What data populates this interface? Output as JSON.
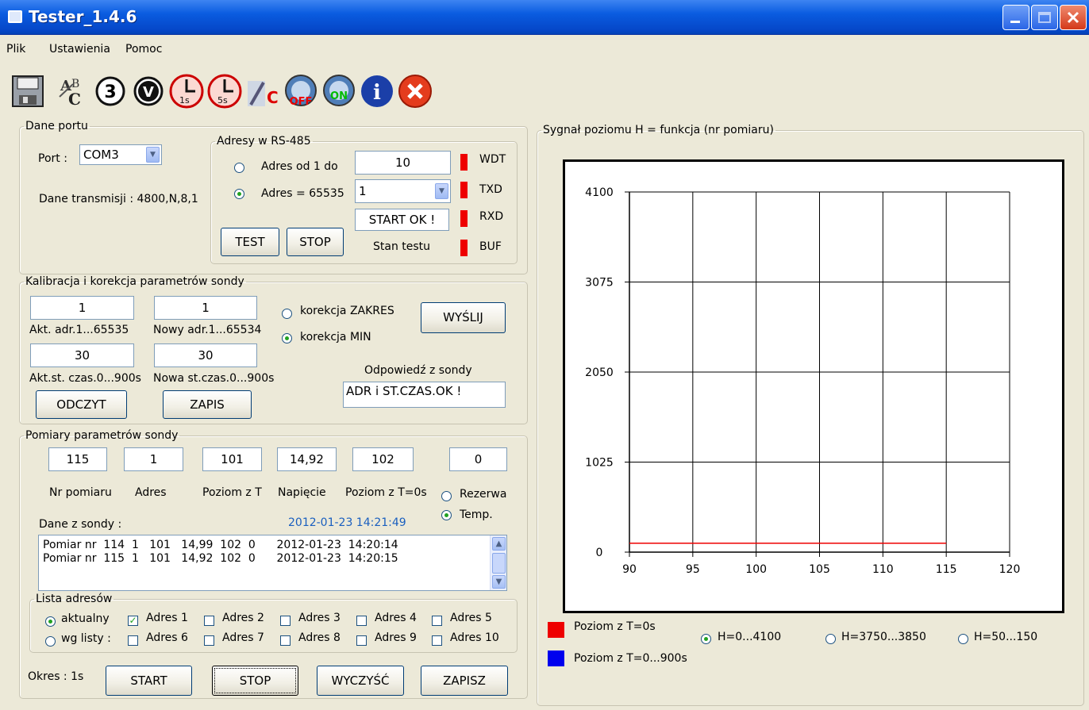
{
  "window": {
    "title": "Tester_1.4.6"
  },
  "menu": {
    "items": [
      "Plik",
      "Ustawienia",
      "Pomoc"
    ]
  },
  "toolbar": {
    "icons": [
      "save-icon",
      "abc-icon",
      "circle-3-icon",
      "circle-v-icon",
      "clock-1s-icon",
      "clock-5s-icon",
      "thermometer-icon",
      "gauge-off-icon",
      "gauge-on-icon",
      "info-icon",
      "close-icon"
    ],
    "labels": {
      "circle3": "3",
      "circleV": "V",
      "clock1": "1s",
      "clock5": "5s",
      "thermo": "C",
      "off": "OFF",
      "on": "ON",
      "info": "i"
    }
  },
  "port": {
    "legend": "Dane portu",
    "port_label": "Port :",
    "port_value": "COM3",
    "transmission": "Dane transmisji : 4800,N,8,1"
  },
  "rs485": {
    "legend": "Adresy w RS-485",
    "range_label": "Adres od 1 do",
    "range_value": "10",
    "single_label": "Adres = 65535",
    "single_value": "1",
    "status_value": "START OK !",
    "test_button": "TEST",
    "stop_button": "STOP",
    "status_label": "Stan testu",
    "leds": [
      "WDT",
      "TXD",
      "RXD",
      "BUF"
    ],
    "led_color": "#e00000"
  },
  "calib": {
    "legend": "Kalibracja i korekcja parametrów sondy",
    "cur_addr": "1",
    "cur_addr_label": "Akt. adr.1...65535",
    "new_addr": "1",
    "new_addr_label": "Nowy adr.1...65534",
    "cur_time": "30",
    "cur_time_label": "Akt.st. czas.0...900s",
    "new_time": "30",
    "new_time_label": "Nowa st.czas.0...900s",
    "radio_range": "korekcja ZAKRES",
    "radio_min": "korekcja MIN",
    "send_button": "WYŚLIJ",
    "reply_label": "Odpowiedź z sondy",
    "reply_value": "ADR i ST.CZAS.OK !",
    "read_button": "ODCZYT",
    "write_button": "ZAPIS"
  },
  "meas": {
    "legend": "Pomiary parametrów sondy",
    "values": [
      "115",
      "1",
      "101",
      "14,92",
      "102",
      "0"
    ],
    "labels": [
      "Nr pomiaru",
      "Adres",
      "Poziom z T",
      "Napięcie",
      "Poziom z T=0s"
    ],
    "radio_reserve": "Rezerwa",
    "radio_temp": "Temp.",
    "data_label": "Dane z sondy :",
    "datetime": "2012-01-23   14:21:49",
    "datetime_color": "#1a5fbf",
    "log": [
      "Pomiar nr  114  1   101   14,99  102  0      2012-01-23  14:20:14",
      "Pomiar nr  115  1   101   14,92  102  0      2012-01-23  14:20:15"
    ]
  },
  "addr_list": {
    "legend": "Lista adresów",
    "radio_current": "aktualny",
    "radio_list": "wg listy  :",
    "checks": [
      "Adres 1",
      "Adres 2",
      "Adres 3",
      "Adres 4",
      "Adres 5",
      "Adres 6",
      "Adres 7",
      "Adres 8",
      "Adres 9",
      "Adres 10"
    ],
    "checked": [
      true,
      false,
      false,
      false,
      false,
      false,
      false,
      false,
      false,
      false
    ]
  },
  "bottom": {
    "period": "Okres : 1s",
    "start": "START",
    "stop": "STOP",
    "clear": "WYCZYŚĆ",
    "save": "ZAPISZ"
  },
  "chart_panel": {
    "legend": "Sygnał poziomu H = funkcja (nr pomiaru)",
    "legend_items": [
      {
        "label": "Poziom z T=0s",
        "color": "#ee0000"
      },
      {
        "label": "Poziom z T=0...900s",
        "color": "#0000ee"
      }
    ],
    "radios": [
      "H=0...4100",
      "H=3750...3850",
      "H=50...150"
    ]
  },
  "chart_data": {
    "type": "line",
    "xlim": [
      90,
      120
    ],
    "ylim": [
      0,
      4100
    ],
    "xticks": [
      "90",
      "95",
      "100",
      "105",
      "110",
      "115",
      "120"
    ],
    "yticks": [
      "0",
      "1025",
      "2050",
      "3075",
      "4100"
    ],
    "grid": true,
    "series": [
      {
        "name": "Poziom z T=0s",
        "color": "#ee0000",
        "x": [
          90,
          115
        ],
        "y": [
          102,
          102
        ]
      }
    ]
  }
}
